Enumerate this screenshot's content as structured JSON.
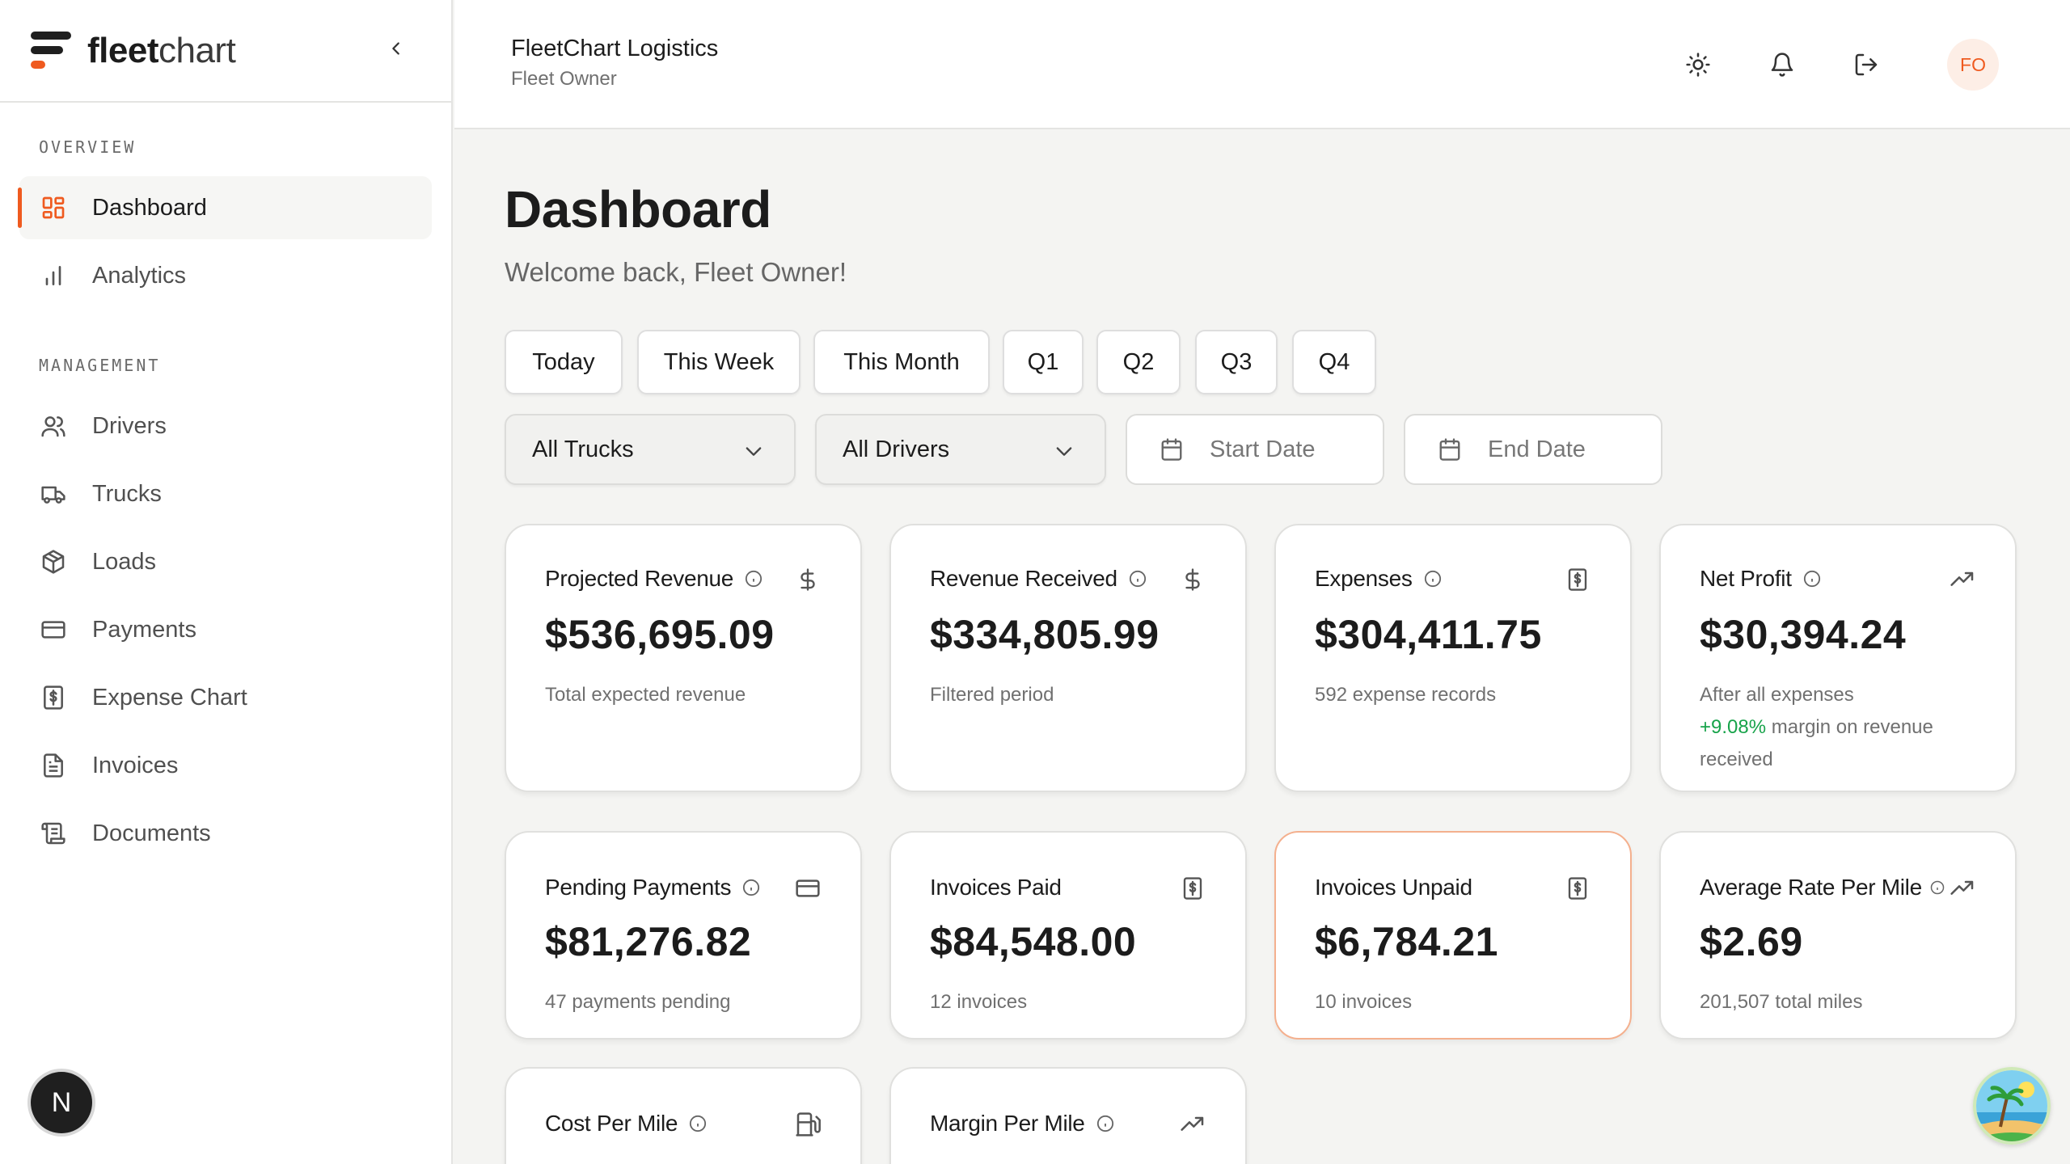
{
  "brand": {
    "name_bold": "fleet",
    "name_light": "chart"
  },
  "sidebar": {
    "overview_label": "OVERVIEW",
    "management_label": "MANAGEMENT",
    "overview_items": [
      {
        "label": "Dashboard",
        "icon": "dashboard-icon",
        "active": true
      },
      {
        "label": "Analytics",
        "icon": "bar-chart-icon",
        "active": false
      }
    ],
    "management_items": [
      {
        "label": "Drivers",
        "icon": "users-icon"
      },
      {
        "label": "Trucks",
        "icon": "truck-icon"
      },
      {
        "label": "Loads",
        "icon": "package-icon"
      },
      {
        "label": "Payments",
        "icon": "credit-card-icon"
      },
      {
        "label": "Expense Chart",
        "icon": "receipt-icon"
      },
      {
        "label": "Invoices",
        "icon": "file-text-icon"
      },
      {
        "label": "Documents",
        "icon": "scroll-icon"
      }
    ],
    "badge_letter": "N"
  },
  "header": {
    "company": "FleetChart Logistics",
    "role": "Fleet Owner",
    "avatar_initials": "FO"
  },
  "main": {
    "title": "Dashboard",
    "subtitle": "Welcome back, Fleet Owner!",
    "period_chips": [
      "Today",
      "This Week",
      "This Month",
      "Q1",
      "Q2",
      "Q3",
      "Q4"
    ],
    "filters": {
      "trucks": "All Trucks",
      "drivers": "All Drivers",
      "start_date_placeholder": "Start Date",
      "end_date_placeholder": "End Date"
    },
    "cards": [
      {
        "label": "Projected Revenue",
        "value": "$536,695.09",
        "note": "Total expected revenue",
        "icon": "dollar-icon",
        "info": true
      },
      {
        "label": "Revenue Received",
        "value": "$334,805.99",
        "note": "Filtered period",
        "icon": "dollar-icon",
        "info": true
      },
      {
        "label": "Expenses",
        "value": "$304,411.75",
        "note": "592 expense records",
        "icon": "receipt-icon",
        "info": true
      },
      {
        "label": "Net Profit",
        "value": "$30,394.24",
        "note": "After all expenses",
        "note_highlight": "+9.08%",
        "note_rest": " margin on revenue received",
        "icon": "trending-up-icon",
        "info": true
      },
      {
        "label": "Pending Payments",
        "value": "$81,276.82",
        "note": "47 payments pending",
        "icon": "credit-card-icon",
        "info": true
      },
      {
        "label": "Invoices Paid",
        "value": "$84,548.00",
        "note": "12 invoices",
        "icon": "receipt-icon",
        "info": false
      },
      {
        "label": "Invoices Unpaid",
        "value": "$6,784.21",
        "note": "10 invoices",
        "icon": "receipt-icon",
        "info": false
      },
      {
        "label": "Average Rate Per Mile",
        "value": "$2.69",
        "note": "201,507 total miles",
        "icon": "trending-up-icon",
        "info": true
      },
      {
        "label": "Cost Per Mile",
        "value": "",
        "note": "",
        "icon": "fuel-icon",
        "info": true
      },
      {
        "label": "Margin Per Mile",
        "value": "",
        "note": "",
        "icon": "trending-up-icon",
        "info": true
      }
    ]
  },
  "colors": {
    "accent": "#ef5a1f",
    "positive": "#17a34a",
    "background": "#f4f4f2"
  }
}
